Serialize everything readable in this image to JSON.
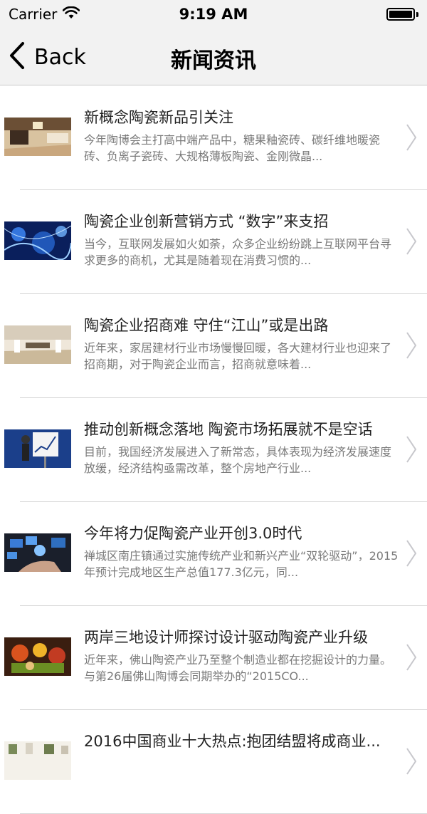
{
  "status_bar": {
    "carrier": "Carrier",
    "time": "9:19 AM",
    "battery_level": 1.0
  },
  "nav": {
    "back_label": "Back",
    "title": "新闻资讯"
  },
  "news": [
    {
      "title": "新概念陶瓷新品引关注",
      "summary": "今年陶博会主打高中端产品中，糖果釉瓷砖、碳纤维地暖瓷砖、负离子瓷砖、大规格薄板陶瓷、金刚微晶...",
      "thumb_icon": "living-room-photo"
    },
    {
      "title": "陶瓷企业创新营销方式 “数字”来支招",
      "summary": "当今，互联网发展如火如荼，众多企业纷纷跳上互联网平台寻求更多的商机，尤其是随着现在消费习惯的...",
      "thumb_icon": "digital-network-photo"
    },
    {
      "title": "陶瓷企业招商难 守住“江山”或是出路",
      "summary": "近年来，家居建材行业市场慢慢回暖，各大建材行业也迎来了招商期，对于陶瓷企业而言，招商就意味着...",
      "thumb_icon": "dining-room-photo"
    },
    {
      "title": "推动创新概念落地 陶瓷市场拓展就不是空话",
      "summary": "目前，我国经济发展进入了新常态，具体表现为经济发展速度放缓，经济结构亟需改革，整个房地产行业...",
      "thumb_icon": "business-chart-photo"
    },
    {
      "title": "今年将力促陶瓷产业开创3.0时代",
      "summary": "禅城区南庄镇通过实施传统产业和新兴产业“双轮驱动”，2015年预计完成地区生产总值177.3亿元，同...",
      "thumb_icon": "technology-hand-photo"
    },
    {
      "title": "两岸三地设计师探讨设计驱动陶瓷产业升级",
      "summary": "近年来，佛山陶瓷产业乃至整个制造业都在挖掘设计的力量。与第26届佛山陶博会同期举办的“2015CO...",
      "thumb_icon": "ceramic-figurines-photo"
    },
    {
      "title": "2016中国商业十大热点:抱团结盟将成商业...",
      "summary": "",
      "thumb_icon": "tableware-photo"
    }
  ]
}
